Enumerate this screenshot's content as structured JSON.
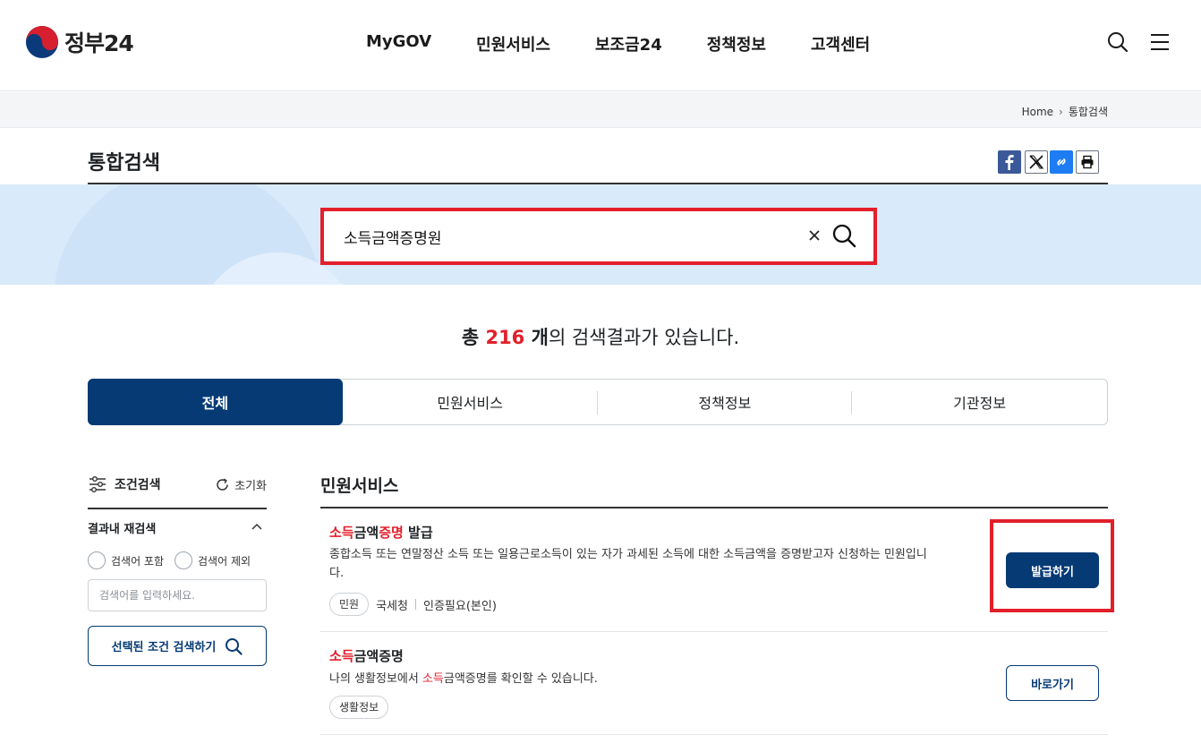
{
  "header": {
    "logo_text": "정부24",
    "nav": [
      "MyGOV",
      "민원서비스",
      "보조금24",
      "정책정보",
      "고객센터"
    ],
    "icons": [
      "search-icon",
      "menu-icon"
    ]
  },
  "breadcrumb": {
    "home": "Home",
    "current": "통합검색"
  },
  "page": {
    "title": "통합검색",
    "share_icons": [
      "facebook-icon",
      "x-icon",
      "link-icon",
      "print-icon"
    ]
  },
  "search": {
    "query": "소득금액증명원"
  },
  "results_summary": {
    "prefix": "총 ",
    "count": "216",
    "unit": " 개",
    "suffix": "의 검색결과가 있습니다."
  },
  "tabs": [
    {
      "label": "전체",
      "active": true
    },
    {
      "label": "민원서비스",
      "active": false
    },
    {
      "label": "정책정보",
      "active": false
    },
    {
      "label": "기관정보",
      "active": false
    }
  ],
  "filter": {
    "title": "조건검색",
    "reset": "초기화",
    "refine_title": "결과내 재검색",
    "include_label": "검색어 포함",
    "exclude_label": "검색어 제외",
    "input_placeholder": "검색어를 입력하세요.",
    "apply_label": "선택된 조건 검색하기"
  },
  "section": {
    "title": "민원서비스"
  },
  "results": [
    {
      "title_parts": [
        {
          "text": "소득",
          "hl": true
        },
        {
          "text": "금액",
          "hl": false
        },
        {
          "text": "증명",
          "hl": true
        },
        {
          "text": " 발급",
          "hl": false
        }
      ],
      "desc_line1": "종합소득 또는 연말정산 소득 또는 일용근로소득이 있는 자가 과세된 소득에 대한 소득금액을 증명받고자 신청하는 민원입니",
      "desc_line2": "다.",
      "chip": "민원",
      "agency": "국세청",
      "auth": "인증필요(본인)",
      "button": "발급하기"
    },
    {
      "title_parts": [
        {
          "text": "소득",
          "hl": true
        },
        {
          "text": "금액증명",
          "hl": false
        }
      ],
      "desc_prefix": "나의 생활정보에서 ",
      "desc_hl": "소득",
      "desc_suffix": "금액증명를 확인할 수 있습니다.",
      "chip": "생활정보",
      "button": "바로가기"
    }
  ],
  "colors": {
    "primary": "#063a74",
    "highlight": "#e2202b",
    "search_band": "#d9eafb"
  }
}
